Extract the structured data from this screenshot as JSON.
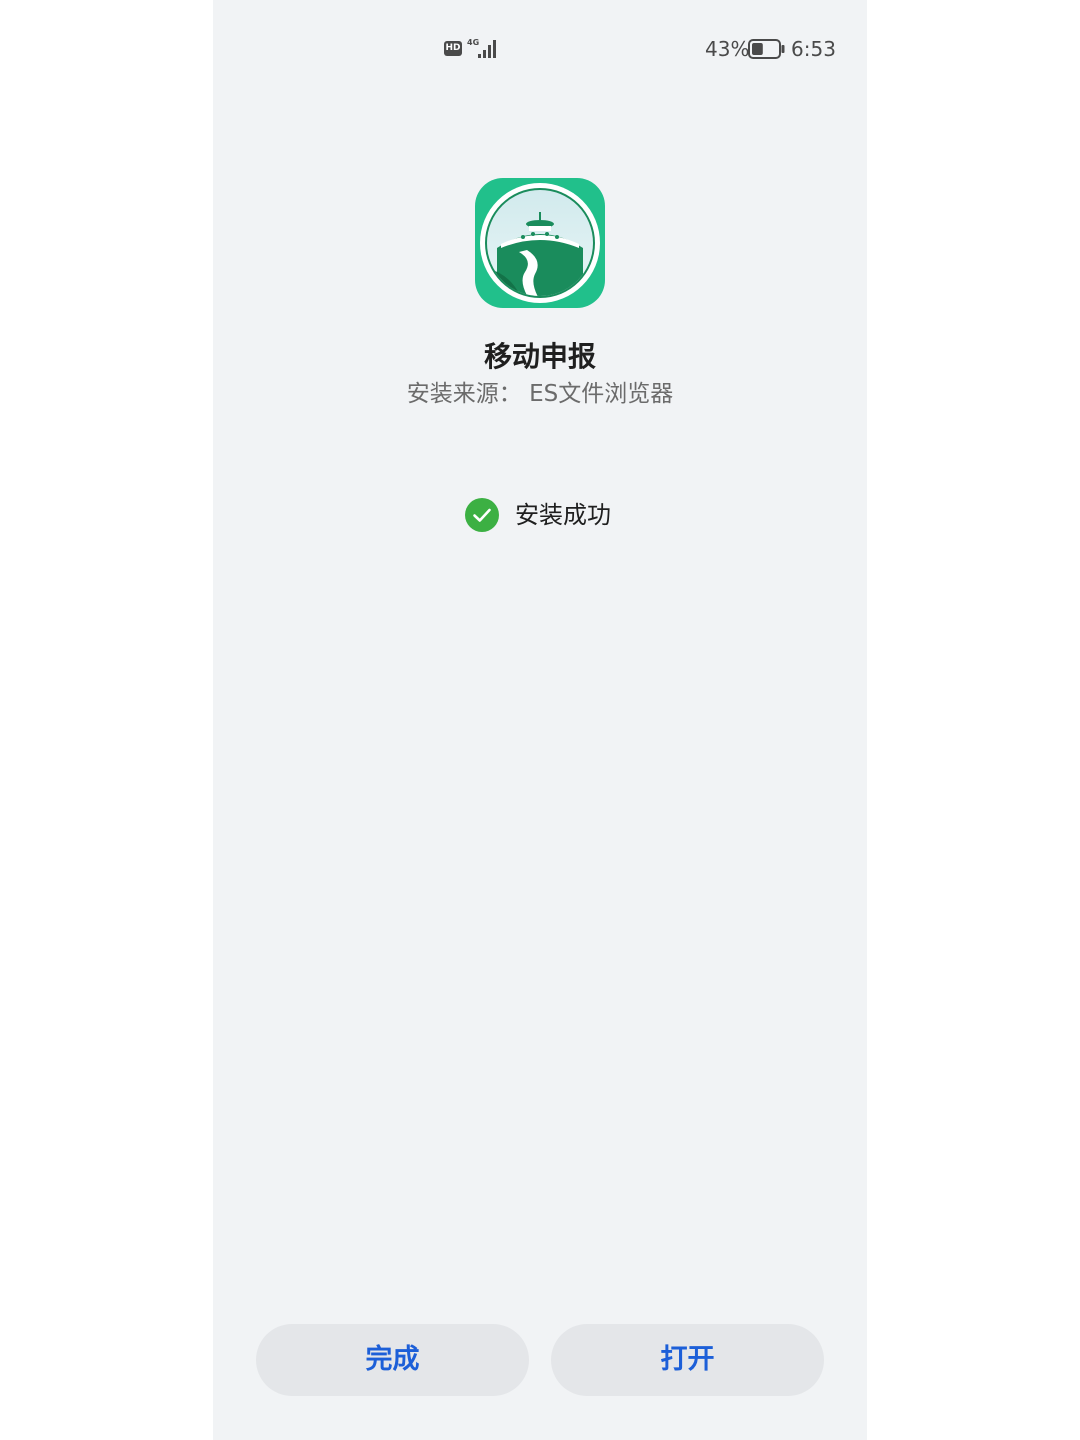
{
  "status_bar": {
    "hd_label": "HD",
    "network_label": "4G",
    "battery_percent": "43%",
    "battery_level": 0.43,
    "time": "6:53"
  },
  "app": {
    "name": "移动申报",
    "install_source": "安装来源：  ES文件浏览器",
    "icon": "app-logo-icon",
    "icon_color": "#21c08b"
  },
  "install_status": {
    "text": "安装成功",
    "icon": "check-circle-icon",
    "color": "#3cb043"
  },
  "buttons": {
    "done_label": "完成",
    "open_label": "打开",
    "label_color": "#1c5fd8"
  }
}
